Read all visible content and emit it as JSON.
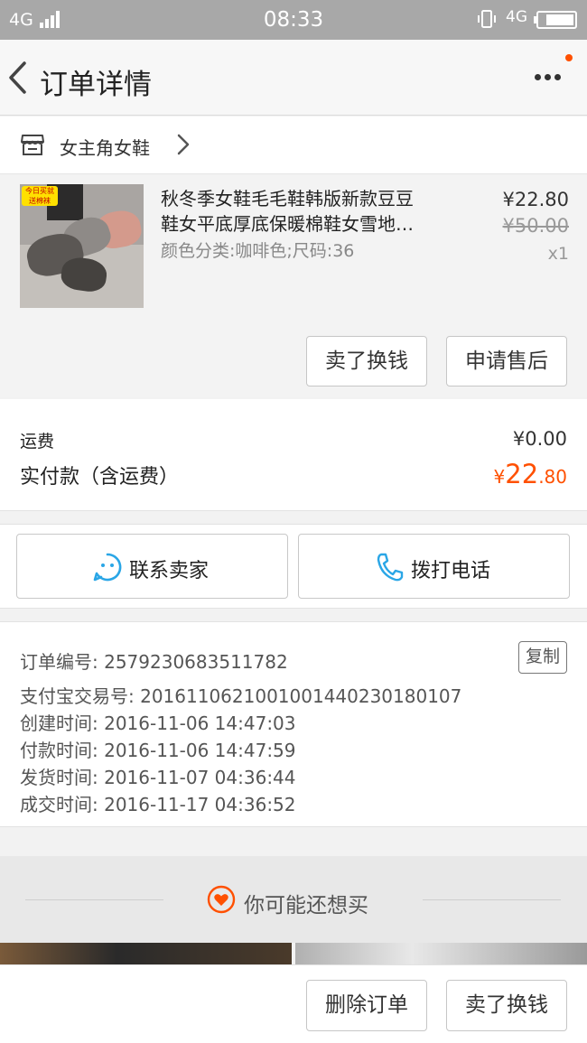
{
  "status_bar": {
    "network_left": "4G",
    "time": "08:33",
    "network_right": "4G",
    "battery_level": 0.8
  },
  "nav": {
    "title": "订单详情",
    "back_icon": "back-chevron-icon",
    "more_icon": "more-dots-icon",
    "badge_color": "#ff5000"
  },
  "shop": {
    "name": "女主角女鞋",
    "icon": "store-icon"
  },
  "product": {
    "promo_badge": [
      "今日买就",
      "送棉袜"
    ],
    "title_lines": [
      "秋冬季女鞋毛毛鞋韩版新款豆豆",
      "鞋女平底厚底保暖棉鞋女雪地…"
    ],
    "variant": "颜色分类:咖啡色;尺码:36",
    "price": "¥22.80",
    "original_price": "¥50.00",
    "quantity": "x1",
    "actions": [
      "卖了换钱",
      "申请售后"
    ]
  },
  "cost": {
    "shipping_label": "运费",
    "shipping_value": "¥0.00",
    "total_label": "实付款（含运费）",
    "total_currency": "¥",
    "total_integer": "22",
    "total_decimal": ".80",
    "accent_color": "#ff5000"
  },
  "contact": {
    "seller_label": "联系卖家",
    "seller_icon": "chat-face-icon",
    "call_label": "拨打电话",
    "call_icon": "phone-icon",
    "icon_color": "#2aa6e6"
  },
  "order_info": {
    "order_number": "订单编号: 2579230683511782",
    "copy_label": "复制",
    "alipay_number": "支付宝交易号: 2016110621001001440230180107",
    "created": "创建时间: 2016-11-06 14:47:03",
    "paid": "付款时间: 2016-11-06 14:47:59",
    "shipped": "发货时间: 2016-11-07 04:36:44",
    "completed": "成交时间: 2016-11-17 04:36:52"
  },
  "recommend": {
    "title": "你可能还想买",
    "icon": "heart-icon"
  },
  "bottom_actions": {
    "delete_label": "删除订单",
    "sell_label": "卖了换钱"
  }
}
